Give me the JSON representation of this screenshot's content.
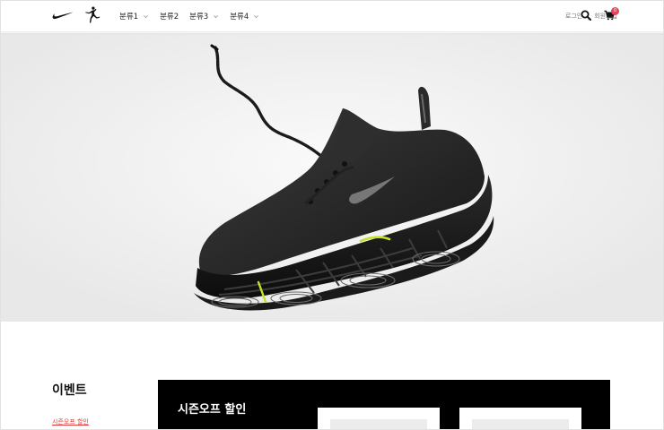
{
  "nav": {
    "items": [
      {
        "label": "분류1",
        "has_dropdown": true
      },
      {
        "label": "분류2",
        "has_dropdown": false
      },
      {
        "label": "분류3",
        "has_dropdown": true
      },
      {
        "label": "분류4",
        "has_dropdown": true
      }
    ]
  },
  "util": {
    "login": "로그인",
    "signup": "회원가입",
    "cart_count": "0"
  },
  "icons": {
    "logo1": "nike-swoosh-logo",
    "logo2": "jordan-jumpman-logo",
    "search": "search-icon",
    "cart": "cart-icon"
  },
  "colors": {
    "badge": "#e8425a",
    "event_link": "#e53935",
    "promo_bg": "#000000",
    "accent_green": "#c6e02a"
  },
  "event": {
    "title": "이벤트",
    "link": "시즌오프 할인"
  },
  "promo": {
    "title": "시즌오프 할인"
  }
}
